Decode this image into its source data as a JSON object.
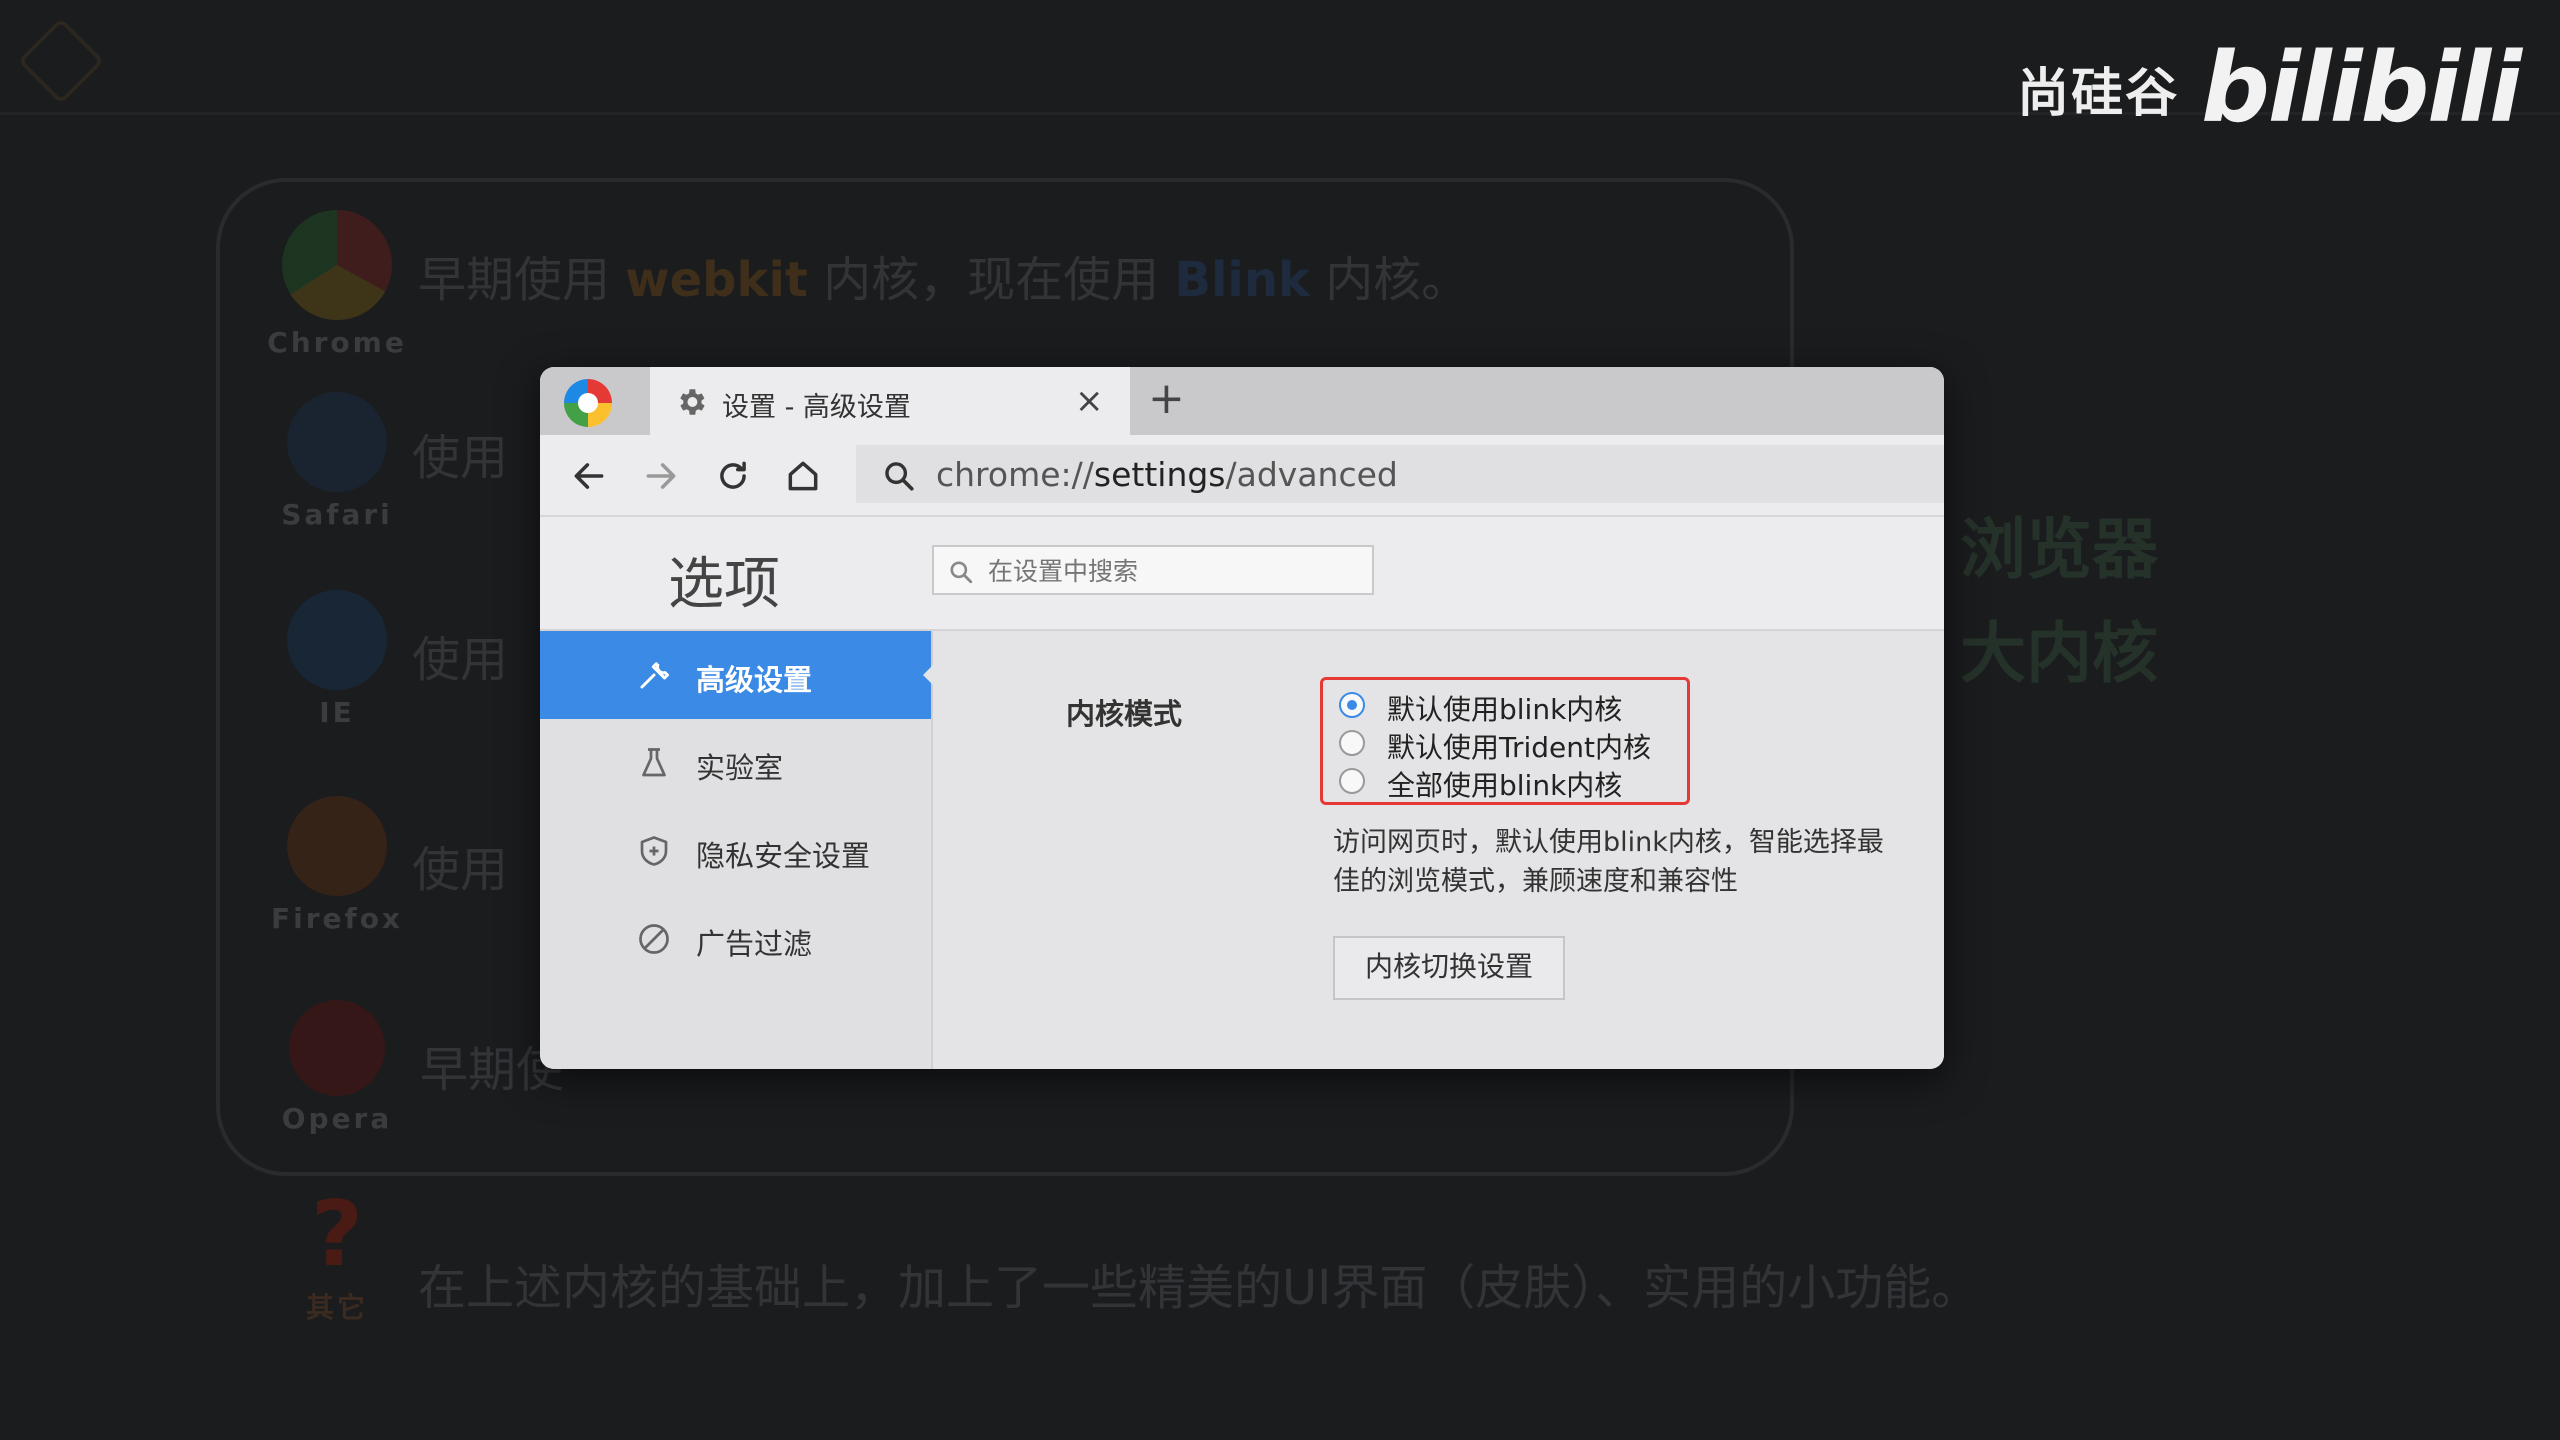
{
  "watermark": {
    "brand_cn": "尚硅谷",
    "brand_bili": "bilibili"
  },
  "background": {
    "rows": [
      {
        "label": "Chrome",
        "text_pre": "早期使用 ",
        "hl1": "webkit",
        "text_mid": " 内核，现在使用 ",
        "hl2": "Blink",
        "text_post": " 内核。"
      },
      {
        "label": "Safari",
        "text": "使用"
      },
      {
        "label": "IE",
        "text": "使用"
      },
      {
        "label": "Firefox",
        "text": "使用"
      },
      {
        "label": "Opera",
        "text": "早期使"
      },
      {
        "label": "其它",
        "text": "在上述内核的基础上，加上了一些精美的UI界面（皮肤）、实用的小功能。"
      }
    ],
    "right_line1": "浏览器",
    "right_line2": "大内核"
  },
  "browser": {
    "tab_title": "设置 - 高级设置",
    "tab_close": "×",
    "new_tab": "+",
    "address_prefix": "chrome://",
    "address_path": "settings",
    "address_suffix": "/advanced"
  },
  "settings": {
    "title": "选项",
    "search_placeholder": "在设置中搜索",
    "sidebar": [
      {
        "label": "高级设置",
        "icon": "wrench-icon",
        "active": true
      },
      {
        "label": "实验室",
        "icon": "flask-icon",
        "active": false
      },
      {
        "label": "隐私安全设置",
        "icon": "shield-icon",
        "active": false
      },
      {
        "label": "广告过滤",
        "icon": "block-icon",
        "active": false
      }
    ],
    "kernel_mode_label": "内核模式",
    "kernel_options": [
      {
        "label": "默认使用blink内核",
        "selected": true
      },
      {
        "label": "默认使用Trident内核",
        "selected": false
      },
      {
        "label": "全部使用blink内核",
        "selected": false
      }
    ],
    "description": "访问网页时，默认使用blink内核，智能选择最佳的浏览模式，兼顾速度和兼容性",
    "switch_button": "内核切换设置"
  },
  "colors": {
    "accent": "#3a8ae6",
    "highlight_border": "#e53935"
  }
}
